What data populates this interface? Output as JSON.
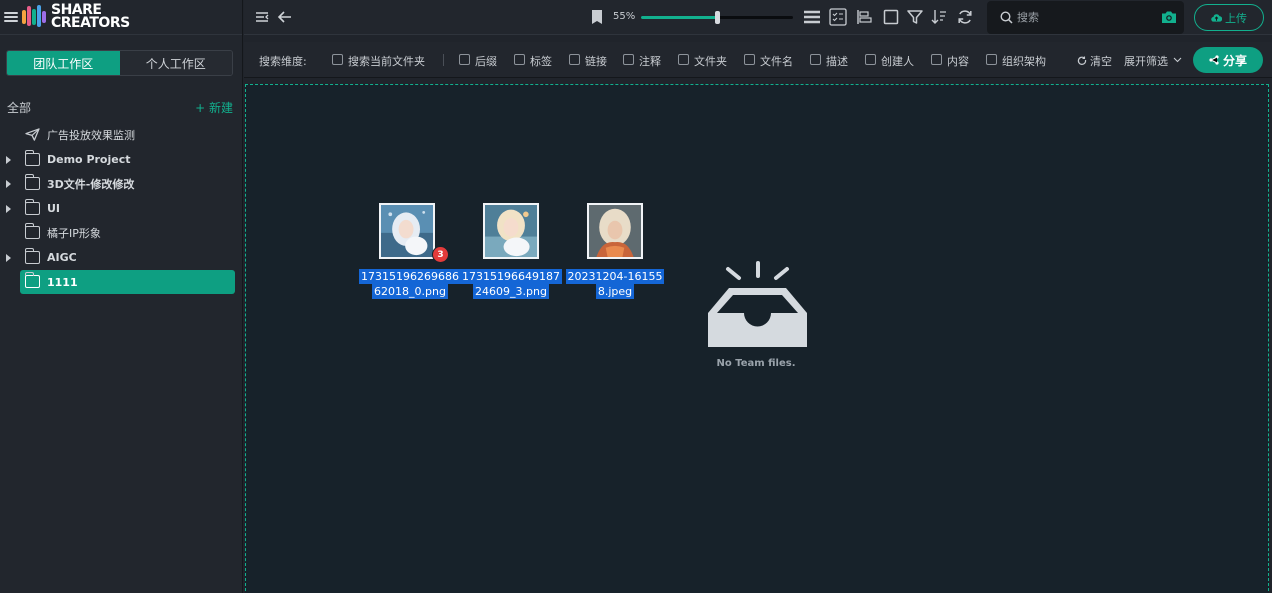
{
  "brand": {
    "line1": "SHARE",
    "line2": "CREATORS"
  },
  "workspace_tabs": [
    {
      "label": "团队工作区",
      "active": true
    },
    {
      "label": "个人工作区",
      "active": false
    }
  ],
  "tree_header": {
    "all_label": "全部",
    "new_label": "+ 新建"
  },
  "tree_items": [
    {
      "label": "广告投放效果监测",
      "icon": "paper-plane-icon",
      "expandable": false,
      "selected": false
    },
    {
      "label": "Demo Project",
      "icon": "folder-icon",
      "expandable": true,
      "selected": false
    },
    {
      "label": "3D文件-修改修改",
      "icon": "folder-icon",
      "expandable": true,
      "selected": false
    },
    {
      "label": "UI",
      "icon": "folder-icon",
      "expandable": true,
      "selected": false
    },
    {
      "label": "橘子IP形象",
      "icon": "folder-icon",
      "expandable": false,
      "selected": false
    },
    {
      "label": "AIGC",
      "icon": "folder-icon",
      "expandable": true,
      "selected": false
    },
    {
      "label": "1111",
      "icon": "folder-icon",
      "expandable": false,
      "selected": true
    }
  ],
  "toolbar": {
    "zoom_label": "55%",
    "zoom_value": 0.55,
    "search_placeholder": "搜索",
    "upload_label": "上传"
  },
  "filters": {
    "label": "搜索维度:",
    "options": [
      "搜索当前文件夹",
      "后缀",
      "标签",
      "链接",
      "注释",
      "文件夹",
      "文件名",
      "描述",
      "创建人",
      "内容",
      "组织架构"
    ],
    "clear_label": "清空",
    "expand_label": "展开筛选",
    "share_label": "分享"
  },
  "files": [
    {
      "name_line1": "17315196269686",
      "name_line2": "62018_0.png",
      "badge": "3"
    },
    {
      "name_line1": "17315196649187",
      "name_line2": "24609_3.png",
      "badge": ""
    },
    {
      "name_line1": "20231204-16155",
      "name_line2": "8.jpeg",
      "badge": ""
    }
  ],
  "empty_state": {
    "text": "No Team files."
  },
  "colors": {
    "accent": "#0e9f82",
    "selection": "#1466d6",
    "badge": "#e33b3b",
    "content_bg": "#17222a"
  }
}
